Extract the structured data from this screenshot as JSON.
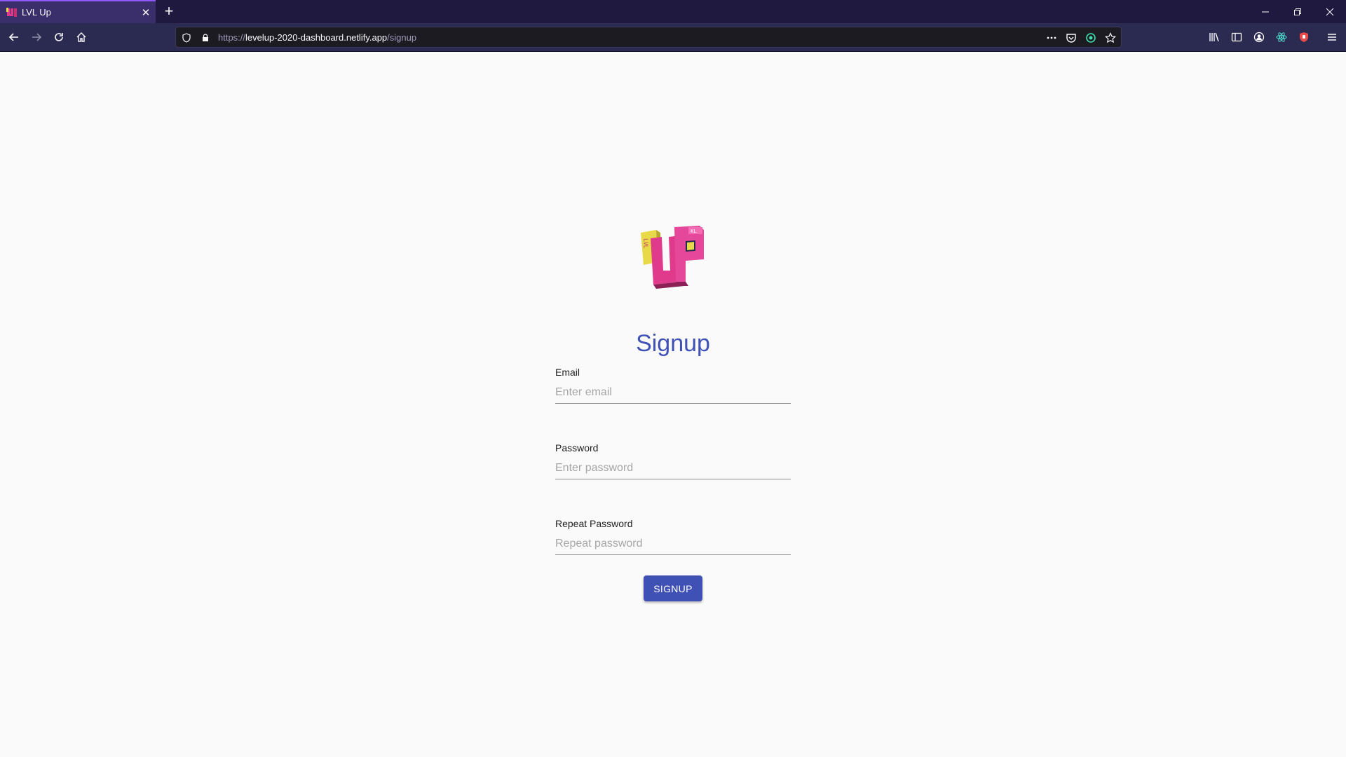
{
  "browser": {
    "tab": {
      "title": "LVL Up",
      "close_glyph": "✕",
      "favicon": "lvlup-favicon-icon"
    },
    "new_tab_glyph": "+",
    "url": {
      "scheme": "https://",
      "host": "levelup-2020-dashboard.netlify.app",
      "path": "/signup"
    },
    "toolbar_icons": [
      "back-icon",
      "forward-icon",
      "reload-icon",
      "home-icon",
      "shield-icon",
      "lock-icon",
      "more-icon",
      "pocket-icon",
      "extension-icon",
      "star-icon",
      "library-icon",
      "sidebar-icon",
      "account-icon",
      "react-devtools-icon",
      "ublock-icon",
      "menu-icon"
    ],
    "colors": {
      "tabbar": "#1f1940",
      "navbar": "#2b2a50",
      "accent": "#9059ff"
    }
  },
  "page": {
    "logo": {
      "name": "lvlup-logo",
      "letters_main": "UP",
      "letters_side": "LVL",
      "letters_badge": "KL"
    },
    "title": "Signup",
    "fields": [
      {
        "label": "Email",
        "placeholder": "Enter email",
        "value": ""
      },
      {
        "label": "Password",
        "placeholder": "Enter password",
        "value": ""
      },
      {
        "label": "Repeat Password",
        "placeholder": "Repeat password",
        "value": ""
      }
    ],
    "submit_label": "SIGNUP",
    "colors": {
      "primary": "#3f51b5",
      "background": "#fafafa"
    }
  }
}
